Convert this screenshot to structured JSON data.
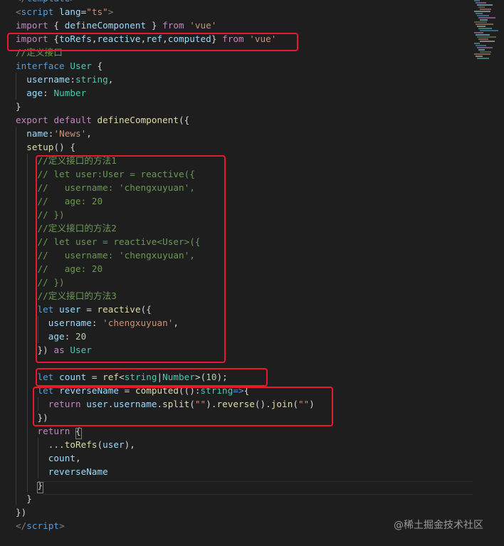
{
  "colors": {
    "background": "#1e1e1e",
    "highlight_box": "#e8192c",
    "keyword": "#569cd6",
    "control": "#c586c0",
    "string": "#ce9178",
    "comment": "#6a9955",
    "variable": "#9cdcfe",
    "function": "#dcdcaa",
    "type": "#4ec9b0",
    "number": "#b5cea8",
    "punctuation": "#d4d4d4",
    "tag": "#569cd6",
    "tag_bracket": "#808080"
  },
  "code_lines": [
    [
      {
        "t": "</",
        "c": "tag_bracket"
      },
      {
        "t": "template",
        "c": "tag"
      },
      {
        "t": ">",
        "c": "tag_bracket"
      }
    ],
    [
      {
        "t": "<",
        "c": "tag_bracket"
      },
      {
        "t": "script",
        "c": "tag"
      },
      {
        "t": " ",
        "c": "punctuation"
      },
      {
        "t": "lang",
        "c": "variable"
      },
      {
        "t": "=",
        "c": "punctuation"
      },
      {
        "t": "\"ts\"",
        "c": "string"
      },
      {
        "t": ">",
        "c": "tag_bracket"
      }
    ],
    [
      {
        "t": "import",
        "c": "control"
      },
      {
        "t": " { ",
        "c": "punctuation"
      },
      {
        "t": "defineComponent",
        "c": "variable"
      },
      {
        "t": " } ",
        "c": "punctuation"
      },
      {
        "t": "from",
        "c": "control"
      },
      {
        "t": " ",
        "c": "punctuation"
      },
      {
        "t": "'vue'",
        "c": "string"
      }
    ],
    [
      {
        "t": "import",
        "c": "control"
      },
      {
        "t": " {",
        "c": "punctuation"
      },
      {
        "t": "toRefs",
        "c": "variable"
      },
      {
        "t": ",",
        "c": "punctuation"
      },
      {
        "t": "reactive",
        "c": "variable"
      },
      {
        "t": ",",
        "c": "punctuation"
      },
      {
        "t": "ref",
        "c": "variable"
      },
      {
        "t": ",",
        "c": "punctuation"
      },
      {
        "t": "computed",
        "c": "variable"
      },
      {
        "t": "} ",
        "c": "punctuation"
      },
      {
        "t": "from",
        "c": "control"
      },
      {
        "t": " ",
        "c": "punctuation"
      },
      {
        "t": "'vue'",
        "c": "string"
      }
    ],
    [
      {
        "t": "//定义接口",
        "c": "comment"
      }
    ],
    [
      {
        "t": "interface",
        "c": "keyword"
      },
      {
        "t": " ",
        "c": "punctuation"
      },
      {
        "t": "User",
        "c": "type"
      },
      {
        "t": " {",
        "c": "punctuation"
      }
    ],
    [
      {
        "t": "  ",
        "c": "punctuation"
      },
      {
        "t": "username",
        "c": "variable"
      },
      {
        "t": ":",
        "c": "punctuation"
      },
      {
        "t": "string",
        "c": "type"
      },
      {
        "t": ",",
        "c": "punctuation"
      }
    ],
    [
      {
        "t": "  ",
        "c": "punctuation"
      },
      {
        "t": "age",
        "c": "variable"
      },
      {
        "t": ": ",
        "c": "punctuation"
      },
      {
        "t": "Number",
        "c": "type"
      }
    ],
    [
      {
        "t": "}",
        "c": "punctuation"
      }
    ],
    [
      {
        "t": "export",
        "c": "control"
      },
      {
        "t": " ",
        "c": "punctuation"
      },
      {
        "t": "default",
        "c": "control"
      },
      {
        "t": " ",
        "c": "punctuation"
      },
      {
        "t": "defineComponent",
        "c": "function"
      },
      {
        "t": "({",
        "c": "punctuation"
      }
    ],
    [
      {
        "t": "  ",
        "c": "punctuation"
      },
      {
        "t": "name",
        "c": "variable"
      },
      {
        "t": ":",
        "c": "punctuation"
      },
      {
        "t": "'News'",
        "c": "string"
      },
      {
        "t": ",",
        "c": "punctuation"
      }
    ],
    [
      {
        "t": "  ",
        "c": "punctuation"
      },
      {
        "t": "setup",
        "c": "function"
      },
      {
        "t": "() {",
        "c": "punctuation"
      }
    ],
    [
      {
        "t": "    ",
        "c": "punctuation"
      },
      {
        "t": "//定义接口的方法1",
        "c": "comment"
      }
    ],
    [
      {
        "t": "    ",
        "c": "punctuation"
      },
      {
        "t": "// let user:User = reactive({",
        "c": "comment"
      }
    ],
    [
      {
        "t": "    ",
        "c": "punctuation"
      },
      {
        "t": "//   username: 'chengxuyuan',",
        "c": "comment"
      }
    ],
    [
      {
        "t": "    ",
        "c": "punctuation"
      },
      {
        "t": "//   age: 20",
        "c": "comment"
      }
    ],
    [
      {
        "t": "    ",
        "c": "punctuation"
      },
      {
        "t": "// })",
        "c": "comment"
      }
    ],
    [
      {
        "t": "    ",
        "c": "punctuation"
      },
      {
        "t": "//定义接口的方法2",
        "c": "comment"
      }
    ],
    [
      {
        "t": "    ",
        "c": "punctuation"
      },
      {
        "t": "// let user = reactive<User>({",
        "c": "comment"
      }
    ],
    [
      {
        "t": "    ",
        "c": "punctuation"
      },
      {
        "t": "//   username: 'chengxuyuan',",
        "c": "comment"
      }
    ],
    [
      {
        "t": "    ",
        "c": "punctuation"
      },
      {
        "t": "//   age: 20",
        "c": "comment"
      }
    ],
    [
      {
        "t": "    ",
        "c": "punctuation"
      },
      {
        "t": "// })",
        "c": "comment"
      }
    ],
    [
      {
        "t": "    ",
        "c": "punctuation"
      },
      {
        "t": "//定义接口的方法3",
        "c": "comment"
      }
    ],
    [
      {
        "t": "    ",
        "c": "punctuation"
      },
      {
        "t": "let",
        "c": "keyword"
      },
      {
        "t": " ",
        "c": "punctuation"
      },
      {
        "t": "user",
        "c": "variable"
      },
      {
        "t": " = ",
        "c": "punctuation"
      },
      {
        "t": "reactive",
        "c": "function"
      },
      {
        "t": "({",
        "c": "punctuation"
      }
    ],
    [
      {
        "t": "      ",
        "c": "punctuation"
      },
      {
        "t": "username",
        "c": "variable"
      },
      {
        "t": ": ",
        "c": "punctuation"
      },
      {
        "t": "'chengxuyuan'",
        "c": "string"
      },
      {
        "t": ",",
        "c": "punctuation"
      }
    ],
    [
      {
        "t": "      ",
        "c": "punctuation"
      },
      {
        "t": "age",
        "c": "variable"
      },
      {
        "t": ": ",
        "c": "punctuation"
      },
      {
        "t": "20",
        "c": "number"
      }
    ],
    [
      {
        "t": "    ",
        "c": "punctuation"
      },
      {
        "t": "}) ",
        "c": "punctuation"
      },
      {
        "t": "as",
        "c": "control"
      },
      {
        "t": " ",
        "c": "punctuation"
      },
      {
        "t": "User",
        "c": "type"
      }
    ],
    [],
    [
      {
        "t": "    ",
        "c": "punctuation"
      },
      {
        "t": "let",
        "c": "keyword"
      },
      {
        "t": " ",
        "c": "punctuation"
      },
      {
        "t": "count",
        "c": "variable"
      },
      {
        "t": " = ",
        "c": "punctuation"
      },
      {
        "t": "ref",
        "c": "function"
      },
      {
        "t": "<",
        "c": "punctuation"
      },
      {
        "t": "string",
        "c": "type"
      },
      {
        "t": "|",
        "c": "punctuation"
      },
      {
        "t": "Number",
        "c": "type"
      },
      {
        "t": ">(",
        "c": "punctuation"
      },
      {
        "t": "10",
        "c": "number"
      },
      {
        "t": ");",
        "c": "punctuation"
      }
    ],
    [
      {
        "t": "    ",
        "c": "punctuation"
      },
      {
        "t": "let",
        "c": "keyword"
      },
      {
        "t": " ",
        "c": "punctuation"
      },
      {
        "t": "reverseName",
        "c": "variable"
      },
      {
        "t": " = ",
        "c": "punctuation"
      },
      {
        "t": "computed",
        "c": "function"
      },
      {
        "t": "(():",
        "c": "punctuation"
      },
      {
        "t": "string",
        "c": "type"
      },
      {
        "t": "=>",
        "c": "keyword"
      },
      {
        "t": "{",
        "c": "punctuation"
      }
    ],
    [
      {
        "t": "      ",
        "c": "punctuation"
      },
      {
        "t": "return",
        "c": "control"
      },
      {
        "t": " ",
        "c": "punctuation"
      },
      {
        "t": "user",
        "c": "variable"
      },
      {
        "t": ".",
        "c": "punctuation"
      },
      {
        "t": "username",
        "c": "variable"
      },
      {
        "t": ".",
        "c": "punctuation"
      },
      {
        "t": "split",
        "c": "function"
      },
      {
        "t": "(",
        "c": "punctuation"
      },
      {
        "t": "\"\"",
        "c": "string"
      },
      {
        "t": ").",
        "c": "punctuation"
      },
      {
        "t": "reverse",
        "c": "function"
      },
      {
        "t": "().",
        "c": "punctuation"
      },
      {
        "t": "join",
        "c": "function"
      },
      {
        "t": "(",
        "c": "punctuation"
      },
      {
        "t": "\"\"",
        "c": "string"
      },
      {
        "t": ")",
        "c": "punctuation"
      }
    ],
    [
      {
        "t": "    ",
        "c": "punctuation"
      },
      {
        "t": "})",
        "c": "punctuation"
      }
    ],
    [
      {
        "t": "    ",
        "c": "punctuation"
      },
      {
        "t": "return",
        "c": "control"
      },
      {
        "t": " {",
        "c": "punctuation"
      }
    ],
    [
      {
        "t": "      ",
        "c": "punctuation"
      },
      {
        "t": "...",
        "c": "punctuation"
      },
      {
        "t": "toRefs",
        "c": "function"
      },
      {
        "t": "(",
        "c": "punctuation"
      },
      {
        "t": "user",
        "c": "variable"
      },
      {
        "t": "),",
        "c": "punctuation"
      }
    ],
    [
      {
        "t": "      ",
        "c": "punctuation"
      },
      {
        "t": "count",
        "c": "variable"
      },
      {
        "t": ",",
        "c": "punctuation"
      }
    ],
    [
      {
        "t": "      ",
        "c": "punctuation"
      },
      {
        "t": "reverseName",
        "c": "variable"
      }
    ],
    [
      {
        "t": "    ",
        "c": "punctuation"
      },
      {
        "t": "}",
        "c": "punctuation"
      }
    ],
    [
      {
        "t": "  ",
        "c": "punctuation"
      },
      {
        "t": "}",
        "c": "punctuation"
      }
    ],
    [
      {
        "t": "})",
        "c": "punctuation"
      }
    ],
    [
      {
        "t": "</",
        "c": "tag_bracket"
      },
      {
        "t": "script",
        "c": "tag"
      },
      {
        "t": ">",
        "c": "tag_bracket"
      }
    ]
  ],
  "highlight_boxes": [
    "import-line",
    "interface-methods",
    "ref-count",
    "computed-reverse"
  ],
  "watermark": "@稀土掘金技术社区"
}
